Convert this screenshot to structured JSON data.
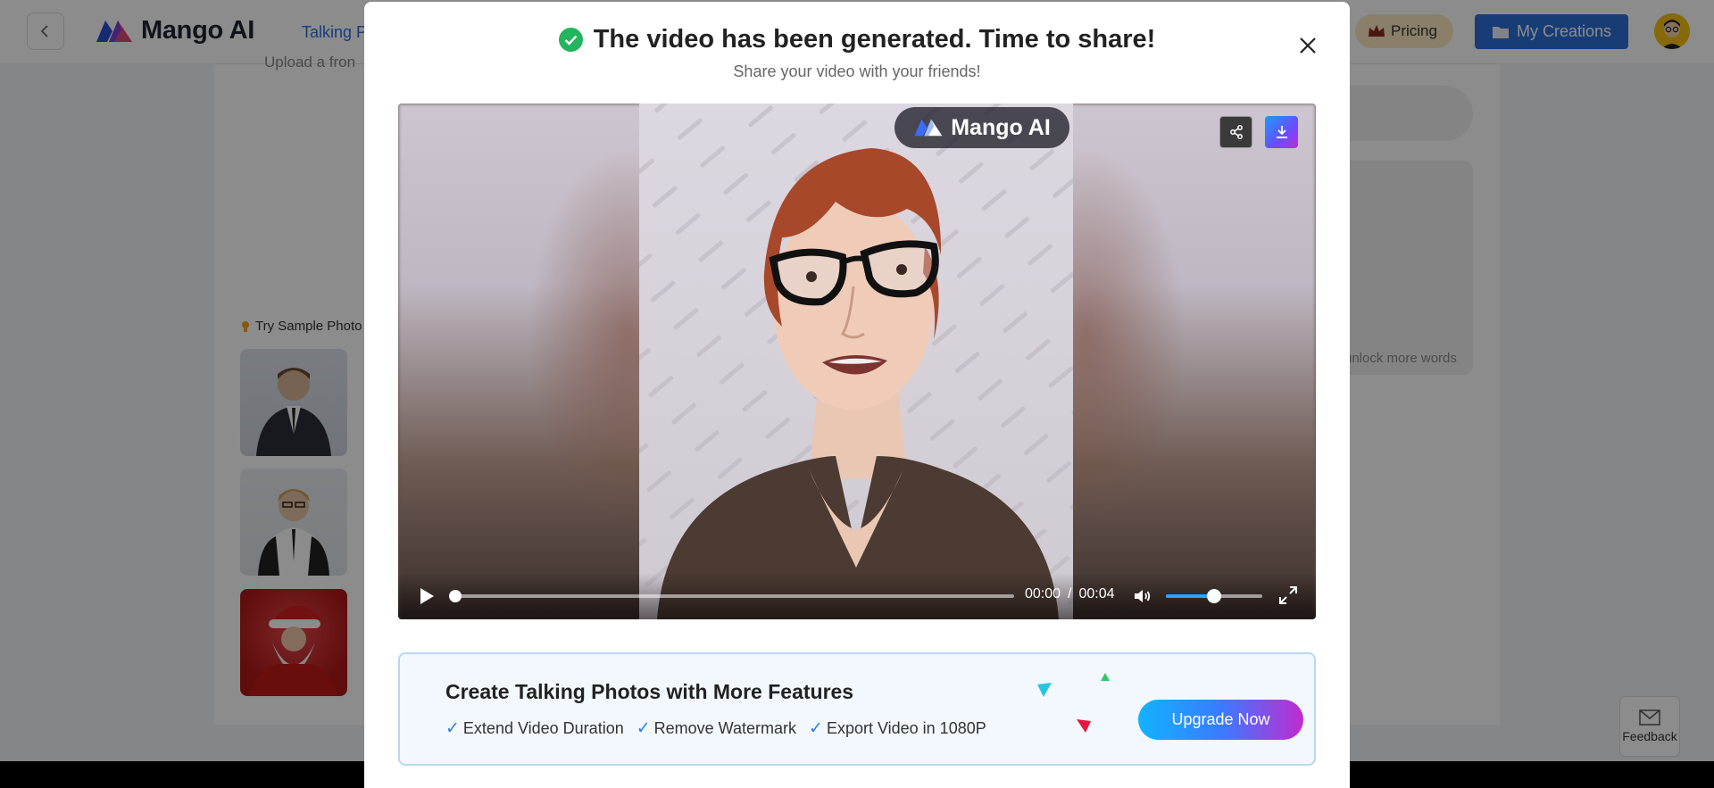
{
  "app": {
    "logo_text": "Mango AI",
    "nav_link": "Talking P",
    "pricing_label": "Pricing",
    "my_creations_label": "My Creations"
  },
  "background": {
    "upload_hint": "Upload a fron",
    "try_sample_label": "Try Sample Photo",
    "unlock_text": "unlock more words",
    "feedback_label": "Feedback"
  },
  "modal": {
    "title": "The video has been generated. Time to share!",
    "subtitle": "Share your video with your friends!",
    "video": {
      "watermark_logo": "Mango AI",
      "current_time": "00:00",
      "separator": "/",
      "duration": "00:04",
      "progress": 0.0,
      "volume": 0.5
    },
    "promo": {
      "title": "Create Talking Photos with More Features",
      "features": [
        "Extend Video Duration",
        "Remove Watermark",
        "Export Video in 1080P"
      ],
      "upgrade_label": "Upgrade Now"
    }
  },
  "colors": {
    "accent_blue": "#2d6fd8",
    "success_green": "#22b45e",
    "pricing_bg": "#fbe7c0",
    "upgrade_gradient_start": "#12b3ff",
    "upgrade_gradient_end": "#c22ad0"
  },
  "icons": {
    "back": "chevron-left-icon",
    "crown": "crown-icon",
    "folder": "folder-icon",
    "check": "check-circle-icon",
    "close": "close-icon",
    "share": "share-icon",
    "download": "download-icon",
    "play": "play-icon",
    "volume": "volume-icon",
    "fullscreen": "fullscreen-icon",
    "mail": "mail-icon"
  }
}
